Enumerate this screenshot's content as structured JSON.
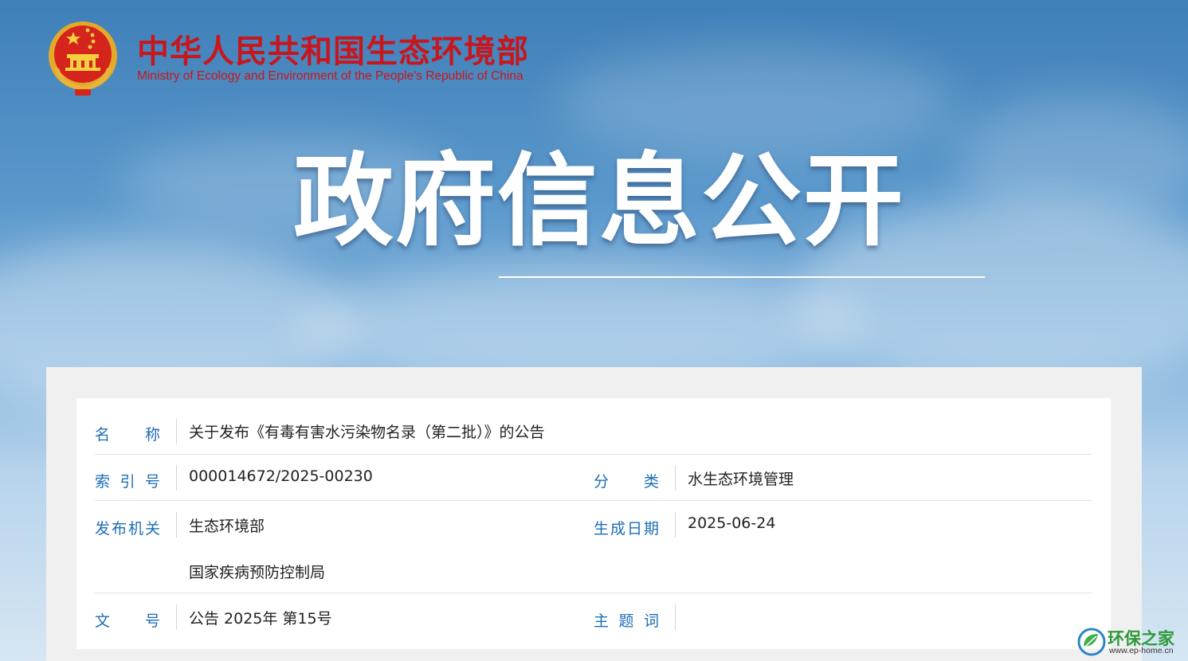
{
  "header": {
    "ministry_cn": "中华人民共和国生态环境部",
    "ministry_en": "Ministry of Ecology and Environment of the People's Republic of China",
    "hero_title": "政府信息公开"
  },
  "info": {
    "name_label": "名称",
    "name_value": "关于发布《有毒有害水污染物名录（第二批）》的公告",
    "index_label": "索引号",
    "index_value": "000014672/2025-00230",
    "category_label": "分类",
    "category_value": "水生态环境管理",
    "issuer_label": "发布机关",
    "issuer_value_1": "生态环境部",
    "issuer_value_2": "国家疾病预防控制局",
    "date_label": "生成日期",
    "date_value": "2025-06-24",
    "doc_no_label": "文号",
    "doc_no_value": "公告 2025年 第15号",
    "keywords_label": "主题词",
    "keywords_value": ""
  },
  "watermark": {
    "name": "环保之家",
    "url": "www.ep-home.cn"
  },
  "colors": {
    "brand_red": "#c8161d",
    "label_blue": "#1c6db5",
    "watermark_green": "#2e9a3c"
  },
  "icons": {
    "emblem": "national-emblem-icon",
    "watermark_logo": "leaf-logo-icon"
  }
}
